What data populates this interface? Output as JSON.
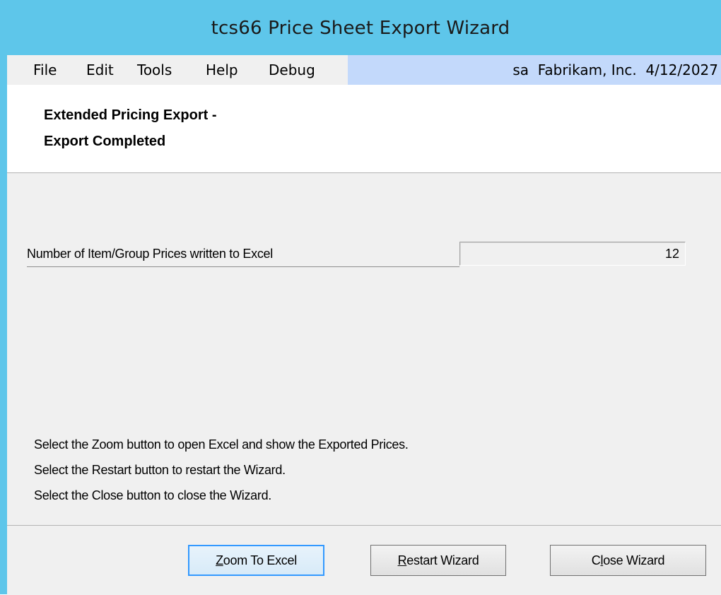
{
  "window": {
    "title": "tcs66 Price Sheet Export Wizard"
  },
  "menu": {
    "items": [
      {
        "label": "File"
      },
      {
        "label": "Edit"
      },
      {
        "label": "Tools"
      },
      {
        "label": "Help"
      },
      {
        "label": "Debug"
      }
    ],
    "status": "sa  Fabrikam, Inc.  4/12/2027"
  },
  "header": {
    "line1": "Extended Pricing Export -",
    "line2": "Export Completed"
  },
  "result": {
    "label": "Number of Item/Group Prices written to Excel",
    "value": "12"
  },
  "instructions": [
    "Select the Zoom button to open Excel and show the Exported Prices.",
    "Select the Restart button to restart the Wizard.",
    "Select the Close button to close the Wizard."
  ],
  "buttons": {
    "zoom": {
      "accel": "Z",
      "rest": "oom To Excel"
    },
    "restart": {
      "accel": "R",
      "rest": "estart Wizard"
    },
    "close": {
      "pre": "C",
      "accel": "l",
      "rest": "ose Wizard"
    }
  },
  "colors": {
    "titlebar": "#5ec6ea",
    "status_bar": "#c3d9fb",
    "panel": "#f0f0f0",
    "default_button_border": "#3399ff"
  }
}
